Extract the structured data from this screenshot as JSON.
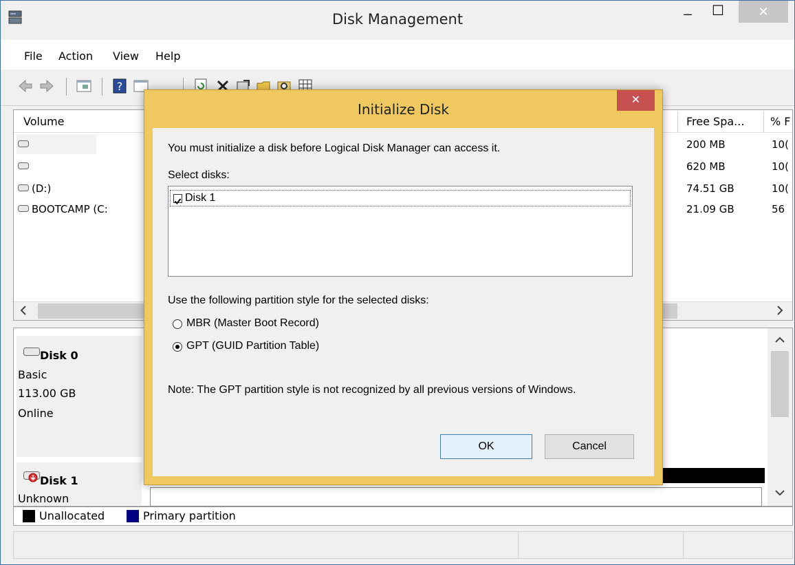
{
  "window": {
    "title": "Disk Management",
    "minimize_glyph": "_",
    "maximize_glyph": "☐",
    "close_glyph": "✕"
  },
  "menu": [
    "File",
    "Action",
    "View",
    "Help"
  ],
  "volume_list": {
    "columns": [
      "Volume",
      "Free Spa...",
      "% F"
    ],
    "rows": [
      {
        "name": "",
        "free": "200 MB",
        "pct": "10("
      },
      {
        "name": "",
        "free": "620 MB",
        "pct": "10("
      },
      {
        "name": "(D:)",
        "free": "74.51 GB",
        "pct": "10("
      },
      {
        "name": "BOOTCAMP (C:",
        "free": "21.09 GB",
        "pct": "56"
      }
    ]
  },
  "disks": [
    {
      "name": "Disk 0",
      "type": "Basic",
      "size": "113.00 GB",
      "status": "Online"
    },
    {
      "name": "Disk 1",
      "type": "Unknown"
    }
  ],
  "legend": {
    "unallocated": "Unallocated",
    "primary": "Primary partition",
    "unallocated_color": "#000000",
    "primary_color": "#000080"
  },
  "dialog": {
    "title": "Initialize Disk",
    "close_glyph": "✕",
    "intro": "You must initialize a disk before Logical Disk Manager can access it.",
    "select_label": "Select disks:",
    "disk_item": "Disk 1",
    "disk_checked": true,
    "style_label": "Use the following partition style for the selected disks:",
    "mbr_label": "MBR (Master Boot Record)",
    "gpt_label": "GPT (GUID Partition Table)",
    "selected_style": "GPT",
    "note": "Note: The GPT partition style is not recognized by all previous versions of Windows.",
    "ok_label": "OK",
    "cancel_label": "Cancel"
  },
  "colors": {
    "dialog_frame": "#f0c860",
    "close_button": "#c75050",
    "window_close": "#c7c7c7"
  }
}
